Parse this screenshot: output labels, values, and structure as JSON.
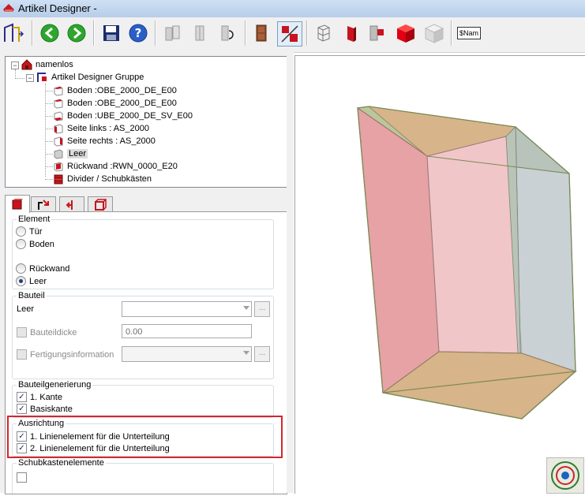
{
  "window": {
    "title": "Artikel Designer -"
  },
  "toolbar": {
    "buttons": [
      "home-icon",
      "back-icon",
      "forward-icon",
      "save-icon",
      "help-icon",
      "panel-copy-icon",
      "panel-split-icon",
      "panel-rotate-icon",
      "door-icon",
      "red-panel-icon",
      "wireframe-icon",
      "red-side-icon",
      "red-back-icon",
      "red-cube-icon",
      "grey-cube-icon",
      "name-icon"
    ],
    "name_label": "$Nam"
  },
  "tree": {
    "root": "namenlos",
    "group": "Artikel Designer Gruppe",
    "items": [
      "Boden :OBE_2000_DE_E00",
      "Boden :OBE_2000_DE_E00",
      "Boden :UBE_2000_DE_SV_E00",
      "Seite links : AS_2000",
      "Seite rechts : AS_2000",
      "Leer",
      "Rückwand :RWN_0000_E20",
      "Divider / Schubkästen"
    ],
    "selected_index": 5
  },
  "element": {
    "title": "Element",
    "options": [
      "Tür",
      "Boden",
      "Rückwand",
      "Leer"
    ],
    "selected": "Leer"
  },
  "bauteil": {
    "title": "Bauteil",
    "label": "Leer",
    "bauteildicke_label": "Bauteildicke",
    "bauteildicke_value": "0.00",
    "fertigung_label": "Fertigungsinformation",
    "dots_label": "..."
  },
  "generierung": {
    "title": "Bauteilgenerierung",
    "items": [
      {
        "label": "1. Kante",
        "checked": true
      },
      {
        "label": "Basiskante",
        "checked": true
      }
    ]
  },
  "ausrichtung": {
    "title": "Ausrichtung",
    "items": [
      {
        "label": "1. Linienelement für die Unterteilung",
        "checked": true
      },
      {
        "label": "2. Linienelement für die Unterteilung",
        "checked": true
      }
    ]
  },
  "schubkasten": {
    "title": "Schubkastenelemente"
  },
  "colors": {
    "highlight": "#d4262f",
    "accent_red": "#c8141e"
  }
}
